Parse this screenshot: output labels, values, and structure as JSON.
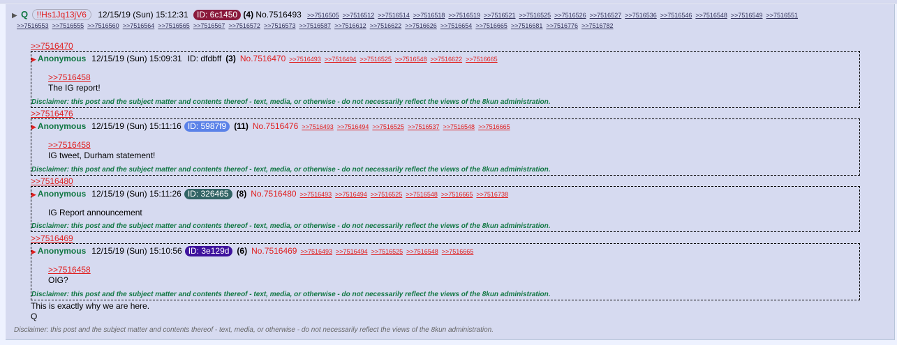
{
  "post": {
    "name": "Q",
    "tripcode": "!!Hs1Jq13jV6",
    "date": "12/15/19 (Sun) 15:12:31",
    "id_label": "ID: 6c1450",
    "id_color": "#8a1a3c",
    "count": "(4)",
    "number": "No.7516493",
    "backlinks": [
      ">>7516505",
      ">>7516512",
      ">>7516514",
      ">>7516518",
      ">>7516519",
      ">>7516521",
      ">>7516525",
      ">>7516526",
      ">>7516527",
      ">>7516536",
      ">>7516546",
      ">>7516548",
      ">>7516549",
      ">>7516551",
      ">>7516553",
      ">>7516555",
      ">>7516560",
      ">>7516564",
      ">>7516565",
      ">>7516567",
      ">>7516572",
      ">>7516573",
      ">>7516587",
      ">>7516612",
      ">>7516622",
      ">>7516626",
      ">>7516654",
      ">>7516665",
      ">>7516681",
      ">>7516776",
      ">>7516782"
    ],
    "body_lines": [
      "This is exactly why we are here.",
      "Q"
    ],
    "disclaimer": "Disclaimer: this post and the subject matter and contents thereof - text, media, or otherwise - do not necessarily reflect the views of the 8kun administration."
  },
  "quotes": [
    {
      "ref": ">>7516470",
      "name": "Anonymous",
      "date": "12/15/19 (Sun) 15:09:31",
      "id_label": "ID: dfdbff",
      "id_color": "",
      "count": "(3)",
      "number": "No.7516470",
      "backlinks": [
        ">>7516493",
        ">>7516494",
        ">>7516525",
        ">>7516548",
        ">>7516622",
        ">>7516665"
      ],
      "quote_link": ">>7516458",
      "text": "The IG report!",
      "disclaimer": "Disclaimer: this post and the subject matter and contents thereof - text, media, or otherwise - do not necessarily reflect the views of the 8kun administration."
    },
    {
      "ref": ">>7516476",
      "name": "Anonymous",
      "date": "12/15/19 (Sun) 15:11:16",
      "id_label": "ID: 5987f9",
      "id_color": "#5b82e8",
      "count": "(11)",
      "number": "No.7516476",
      "backlinks": [
        ">>7516493",
        ">>7516494",
        ">>7516525",
        ">>7516537",
        ">>7516548",
        ">>7516665"
      ],
      "quote_link": ">>7516458",
      "text": "IG tweet, Durham statement!",
      "disclaimer": "Disclaimer: this post and the subject matter and contents thereof - text, media, or otherwise - do not necessarily reflect the views of the 8kun administration."
    },
    {
      "ref": ">>7516480",
      "name": "Anonymous",
      "date": "12/15/19 (Sun) 15:11:26",
      "id_label": "ID: 326465",
      "id_color": "#326465",
      "count": "(8)",
      "number": "No.7516480",
      "backlinks": [
        ">>7516493",
        ">>7516494",
        ">>7516525",
        ">>7516548",
        ">>7516665",
        ">>7516738"
      ],
      "quote_link": "",
      "text": "IG Report announcement",
      "disclaimer": "Disclaimer: this post and the subject matter and contents thereof - text, media, or otherwise - do not necessarily reflect the views of the 8kun administration."
    },
    {
      "ref": ">>7516469",
      "name": "Anonymous",
      "date": "12/15/19 (Sun) 15:10:56",
      "id_label": "ID: 3e129d",
      "id_color": "#3e129d",
      "count": "(6)",
      "number": "No.7516469",
      "backlinks": [
        ">>7516493",
        ">>7516494",
        ">>7516525",
        ">>7516548",
        ">>7516665"
      ],
      "quote_link": ">>7516458",
      "text": "OIG?",
      "disclaimer": "Disclaimer: this post and the subject matter and contents thereof - text, media, or otherwise - do not necessarily reflect the views of the 8kun administration."
    }
  ]
}
